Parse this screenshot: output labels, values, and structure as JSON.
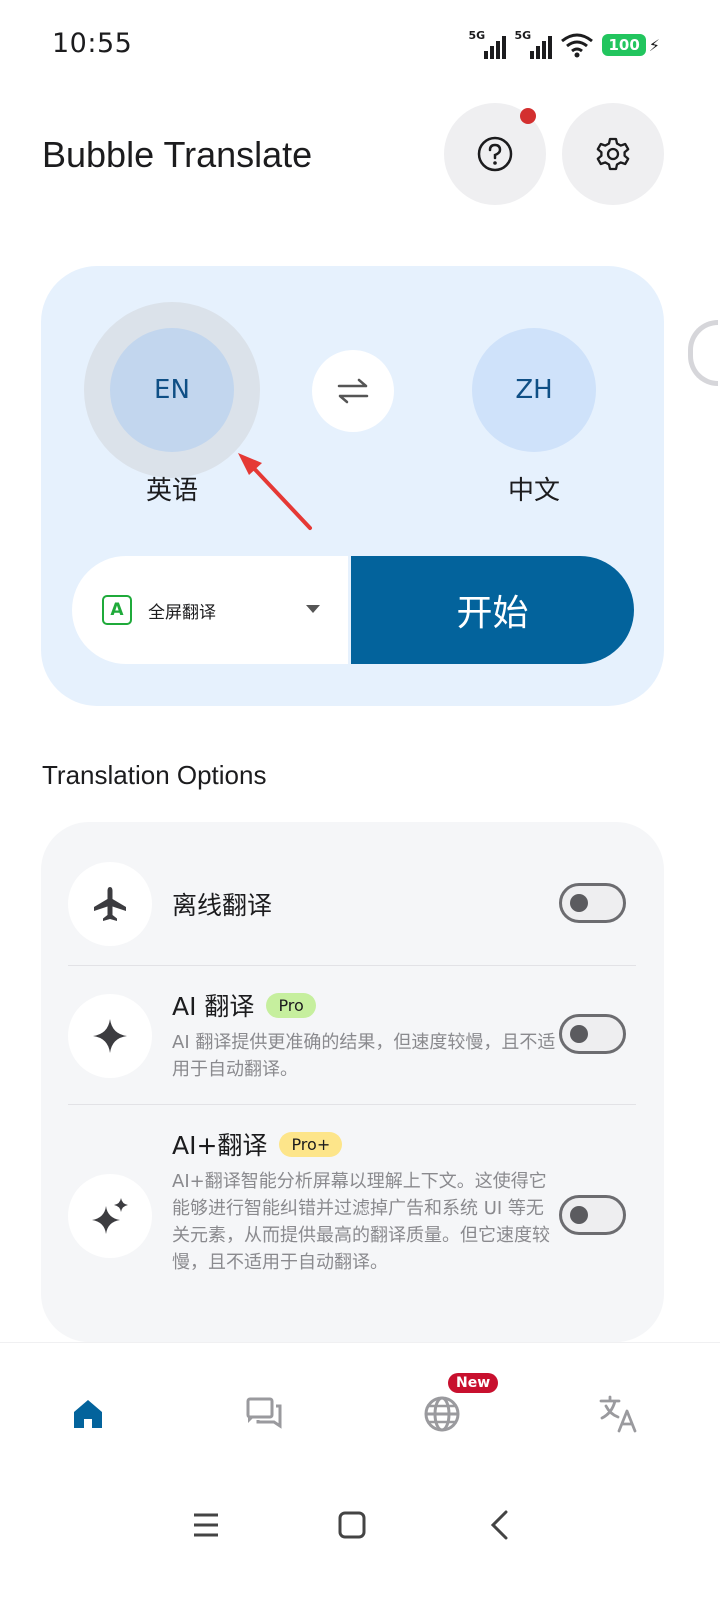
{
  "status_bar": {
    "time": "10:55",
    "network_1": "5G",
    "network_2": "5G",
    "battery": "100"
  },
  "header": {
    "title": "Bubble Translate",
    "help_icon": "help-circle-icon",
    "settings_icon": "gear-icon"
  },
  "language": {
    "source_code": "EN",
    "source_name": "英语",
    "target_code": "ZH",
    "target_name": "中文",
    "swap_icon": "swap-arrows-icon"
  },
  "mode": {
    "icon_letter": "A",
    "label": "全屏翻译"
  },
  "start_label": "开始",
  "options": {
    "section_title": "Translation Options",
    "items": [
      {
        "title": "离线翻译",
        "badge": "",
        "description": "",
        "icon": "airplane-icon",
        "enabled": false
      },
      {
        "title": "AI 翻译",
        "badge": "Pro",
        "description": "AI 翻译提供更准确的结果，但速度较慢，且不适用于自动翻译。",
        "icon": "sparkle-icon",
        "enabled": false
      },
      {
        "title": "AI+翻译",
        "badge": "Pro+",
        "description": "AI+翻译智能分析屏幕以理解上下文。这使得它能够进行智能纠错并过滤掉广告和系统 UI 等无关元素，从而提供最高的翻译质量。但它速度较慢，且不适用于自动翻译。",
        "icon": "sparkles-icon",
        "enabled": false
      }
    ]
  },
  "bottom_nav": {
    "new_badge": "New",
    "items": [
      "home-icon",
      "chat-icon",
      "globe-icon",
      "translate-icon"
    ]
  },
  "colors": {
    "primary": "#03639c",
    "card_bg": "#e6f1fd",
    "annotation": "#e53935"
  }
}
